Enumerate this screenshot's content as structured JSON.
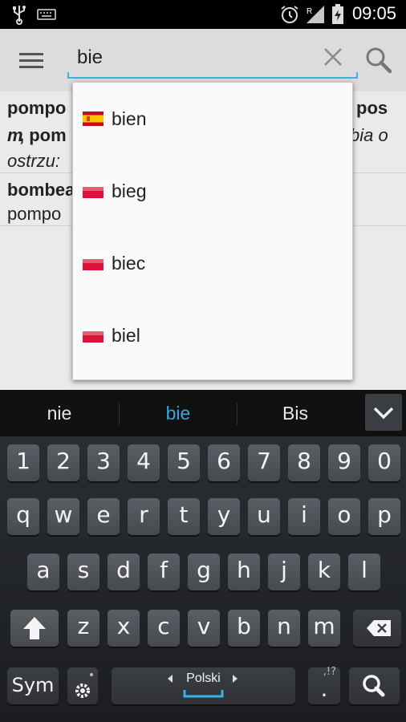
{
  "status_bar": {
    "time": "09:05",
    "icons": [
      "usb-icon",
      "keyboard-icon",
      "alarm-icon",
      "signal-roaming-icon",
      "battery-charging-icon"
    ]
  },
  "toolbar": {
    "menu_icon": "hamburger-icon",
    "search_value": "bie",
    "clear_icon": "close-icon",
    "search_icon": "search-icon"
  },
  "entries": [
    {
      "headword": "pompo",
      "headword_right": "pos",
      "line2_bold_a": "m",
      "line2_bold_b": ", pom",
      "line2_right": "bia o",
      "line3": "ostrzu:"
    },
    {
      "headword": "bombea",
      "line2": "pompo"
    }
  ],
  "suggestions": [
    {
      "word": "bien",
      "flag": "es"
    },
    {
      "word": "bieg",
      "flag": "pl"
    },
    {
      "word": "biec",
      "flag": "pl"
    },
    {
      "word": "biel",
      "flag": "pl"
    }
  ],
  "keyboard": {
    "candidates": [
      "nie",
      "bie",
      "Bis"
    ],
    "active_candidate": 1,
    "row_numbers": [
      "1",
      "2",
      "3",
      "4",
      "5",
      "6",
      "7",
      "8",
      "9",
      "0"
    ],
    "row1": [
      "q",
      "w",
      "e",
      "r",
      "t",
      "y",
      "u",
      "i",
      "o",
      "p"
    ],
    "row2": [
      "a",
      "s",
      "d",
      "f",
      "g",
      "h",
      "j",
      "k",
      "l"
    ],
    "row3": [
      "z",
      "x",
      "c",
      "v",
      "b",
      "n",
      "m"
    ],
    "sym_label": "Sym",
    "space_language": "Polski",
    "period_label": ".",
    "period_hint": ",!?",
    "accent_color": "#33b5e5"
  }
}
